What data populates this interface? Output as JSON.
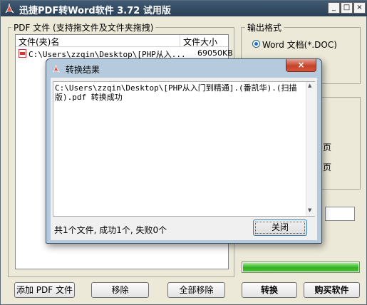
{
  "window": {
    "title": "迅捷PDF转Word软件 3.72 试用版",
    "min_label": "_",
    "max_label": "□",
    "close_label": "×"
  },
  "file_panel": {
    "legend": "PDF 文件 (支持拖文件及文件夹拖拽)",
    "columns": [
      "文件(夹)名",
      "文件大小"
    ],
    "rows": [
      {
        "name": "C:\\Users\\zzqin\\Desktop\\[PHP从入...",
        "size": "69050KB"
      }
    ]
  },
  "output_panel": {
    "legend": "输出格式",
    "radio_label": "Word 文档(*.DOC)",
    "partial_text_1": "页",
    "partial_text_2": "页"
  },
  "buttons": {
    "add_pdf": "添加 PDF 文件",
    "remove": "移除",
    "remove_all": "全部移除",
    "convert": "转换",
    "buy": "购买软件"
  },
  "progress": {
    "value": 1.0,
    "color": "#32b020"
  },
  "dialog": {
    "title": "转换结果",
    "message": "C:\\Users\\zzqin\\Desktop\\[PHP从入门到精通].(番凯华).(扫描版).pdf  转换成功",
    "status": "共1个文件, 成功1个, 失败0个",
    "close_button": "关闭",
    "close_x": "×"
  },
  "colors": {
    "titlebar": "#2b4055",
    "dialog_frame": "#b5cadd",
    "dialog_close": "#c4432c"
  }
}
